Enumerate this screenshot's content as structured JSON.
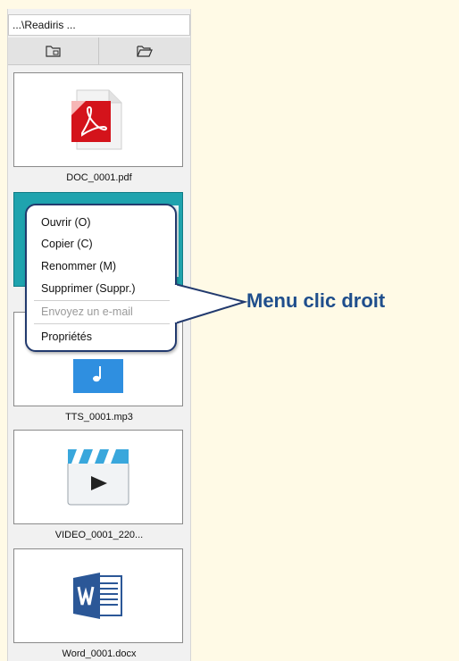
{
  "path": "...\\Readiris ...",
  "toolbar": {
    "left_icon": "folder-image-icon",
    "right_icon": "folder-open-icon"
  },
  "files": [
    {
      "name": "DOC_0001.pdf",
      "icon": "pdf-icon"
    },
    {
      "name": "",
      "icon": "selected-thumbnail"
    },
    {
      "name": "TTS_0001.mp3",
      "icon": "audio-icon"
    },
    {
      "name": "VIDEO_0001_220...",
      "icon": "video-icon"
    },
    {
      "name": "Word_0001.docx",
      "icon": "word-icon"
    }
  ],
  "context_menu": {
    "items": [
      {
        "label": "Ouvrir (O)",
        "enabled": true
      },
      {
        "label": "Copier (C)",
        "enabled": true
      },
      {
        "label": "Renommer (M)",
        "enabled": true
      },
      {
        "label": "Supprimer (Suppr.)",
        "enabled": true
      },
      {
        "label": "Envoyez un e-mail",
        "enabled": false
      },
      {
        "label": "Propriétés",
        "enabled": true
      }
    ]
  },
  "annotation": {
    "label": "Menu clic droit"
  },
  "colors": {
    "background": "#fffae6",
    "selection": "#1fa3ae",
    "callout_border": "#223a6e",
    "callout_text": "#1f4e8c"
  }
}
